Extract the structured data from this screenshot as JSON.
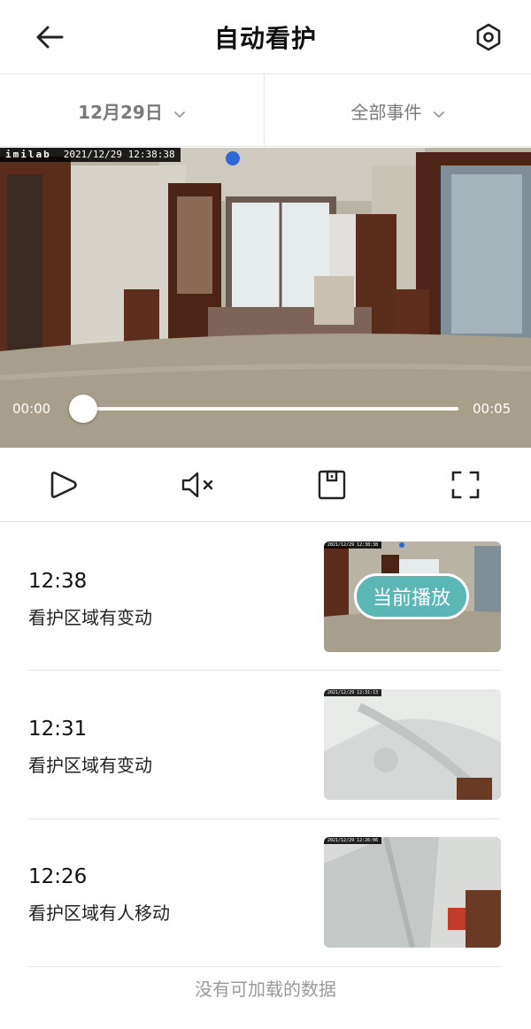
{
  "header": {
    "title": "自动看护",
    "back_icon": "arrow-left-icon",
    "settings_icon": "hexagon-gear-icon"
  },
  "filters": {
    "date_label": "12月29日",
    "event_label": "全部事件"
  },
  "video": {
    "brand": "imilab",
    "timestamp": "2021/12/29 12:38:38",
    "current_time": "00:00",
    "end_time": "00:05",
    "progress": 0
  },
  "controls": {
    "play_icon": "play-icon",
    "mute_icon": "speaker-muted-icon",
    "save_icon": "save-icon",
    "fullscreen_icon": "fullscreen-icon"
  },
  "events": [
    {
      "time": "12:38",
      "desc": "看护区域有变动",
      "playing_label": "当前播放",
      "thumb_ts": "2021/12/29 12:38:38"
    },
    {
      "time": "12:31",
      "desc": "看护区域有变动",
      "thumb_ts": "2021/12/29 12:31:13"
    },
    {
      "time": "12:26",
      "desc": "看护区域有人移动",
      "thumb_ts": "2021/12/29 12:26:06"
    }
  ],
  "footer": {
    "no_more": "没有可加载的数据"
  },
  "colors": {
    "accent": "#5ab7b6",
    "divider": "#e6e6e6",
    "muted_text": "#9a9a9a"
  }
}
